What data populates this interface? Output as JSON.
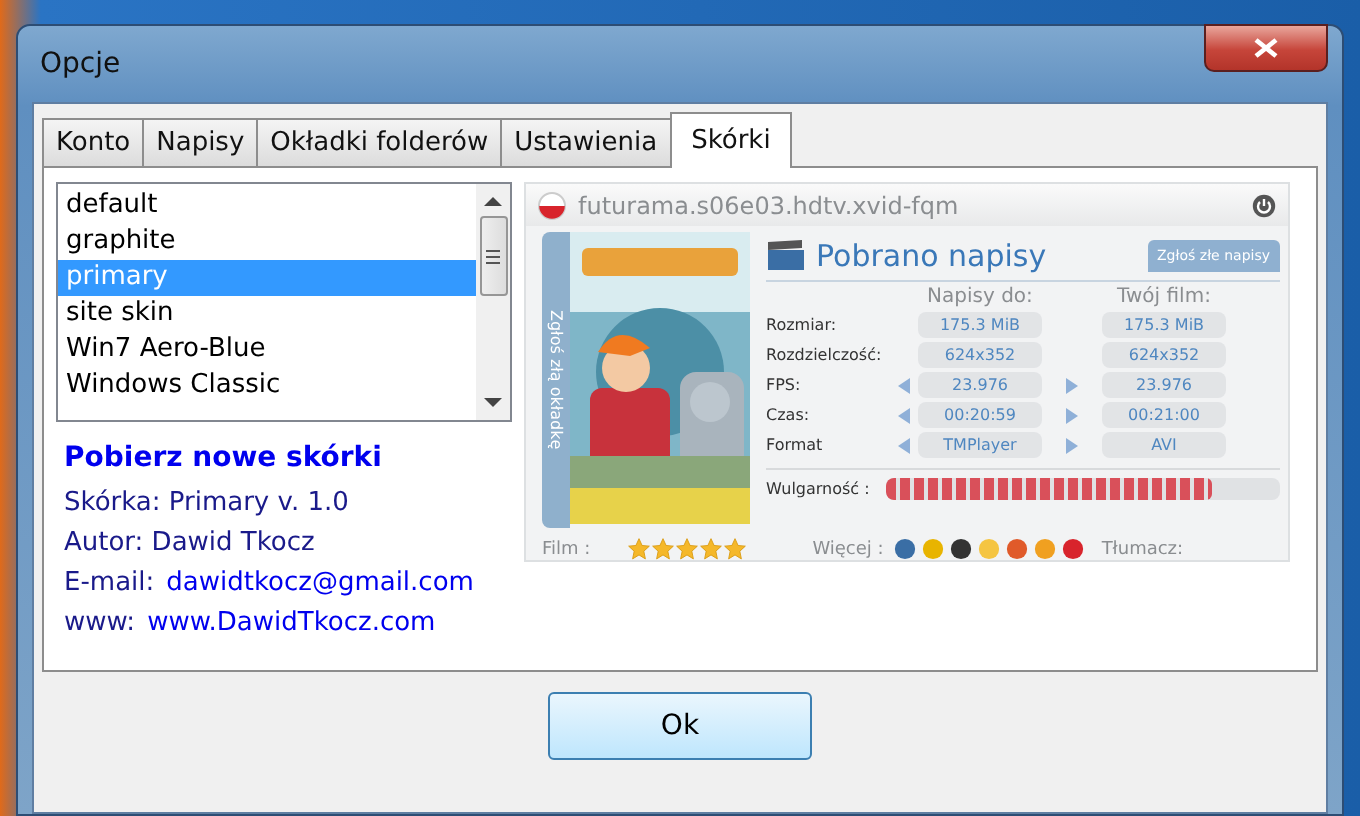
{
  "window": {
    "title": "Opcje"
  },
  "tabs": [
    {
      "label": "Konto",
      "selected": false
    },
    {
      "label": "Napisy",
      "selected": false
    },
    {
      "label": "Okładki folderów",
      "selected": false
    },
    {
      "label": "Ustawienia",
      "selected": false
    },
    {
      "label": "Skórki",
      "selected": true
    }
  ],
  "skin_list": {
    "items": [
      {
        "label": "default",
        "selected": false
      },
      {
        "label": "graphite",
        "selected": false
      },
      {
        "label": "primary",
        "selected": true
      },
      {
        "label": "site skin",
        "selected": false
      },
      {
        "label": "Win7 Aero-Blue",
        "selected": false
      },
      {
        "label": "Windows Classic",
        "selected": false
      }
    ]
  },
  "download_link": "Pobierz nowe skórki",
  "skin_info": {
    "skin": "Skórka: Primary v. 1.0",
    "author": "Autor: Dawid Tkocz",
    "email_label": "E-mail:",
    "email": "dawidtkocz@gmail.com",
    "www_label": "www:",
    "www": "www.DawidTkocz.com"
  },
  "preview": {
    "filename": "futurama.s06e03.hdtv.xvid-fqm",
    "side_tab": "Zgłoś złą okładkę",
    "status": "Pobrano napisy",
    "report_button": "Zgłoś złe napisy",
    "columns": [
      "Napisy do:",
      "Twój film:"
    ],
    "rows": [
      {
        "label": "Rozmiar:",
        "subtitles": "175.3 MiB",
        "film": "175.3 MiB",
        "arrows": false
      },
      {
        "label": "Rozdzielczość:",
        "subtitles": "624x352",
        "film": "624x352",
        "arrows": false
      },
      {
        "label": "FPS:",
        "subtitles": "23.976",
        "film": "23.976",
        "arrows": true
      },
      {
        "label": "Czas:",
        "subtitles": "00:20:59",
        "film": "00:21:00",
        "arrows": true
      },
      {
        "label": "Format",
        "subtitles": "TMPlayer",
        "film": "AVI",
        "arrows": true
      }
    ],
    "vulgarity": {
      "label": "Wulgarność :",
      "level": 0.83
    },
    "film": {
      "label": "Film :",
      "stars": 5
    },
    "more_label": "Więcej :",
    "translator_label": "Tłumacz:"
  },
  "buttons": [
    "Ok"
  ]
}
